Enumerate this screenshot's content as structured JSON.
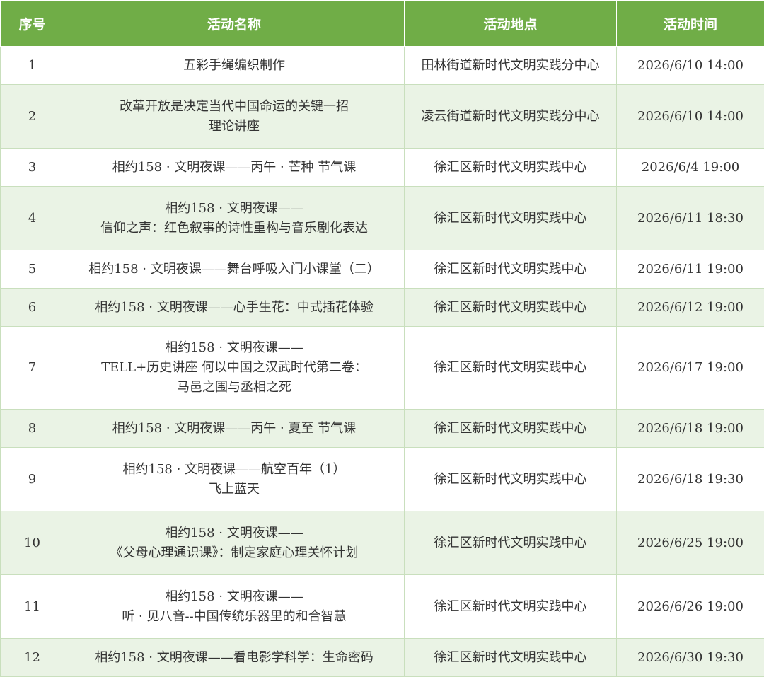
{
  "colors": {
    "header_bg": "#70ad47",
    "header_text": "#ffffff",
    "row_alt_bg": "#eaf3e5",
    "row_bg": "#ffffff",
    "border": "#c9dfbd"
  },
  "table": {
    "headers": {
      "no": "序号",
      "name": "活动名称",
      "place": "活动地点",
      "time": "活动时间"
    },
    "rows": [
      {
        "no": "1",
        "name": [
          "五彩手绳编织制作"
        ],
        "place": "田林街道新时代文明实践分中心",
        "time": "2026/6/10 14:00"
      },
      {
        "no": "2",
        "name": [
          "改革开放是决定当代中国命运的关键一招",
          "理论讲座"
        ],
        "place": "凌云街道新时代文明实践分中心",
        "time": "2026/6/10 14:00"
      },
      {
        "no": "3",
        "name": [
          "相约158 · 文明夜课——丙午 · 芒种 节气课"
        ],
        "place": "徐汇区新时代文明实践中心",
        "time": "2026/6/4 19:00"
      },
      {
        "no": "4",
        "name": [
          "相约158 · 文明夜课——",
          "信仰之声：红色叙事的诗性重构与音乐剧化表达"
        ],
        "place": "徐汇区新时代文明实践中心",
        "time": "2026/6/11 18:30"
      },
      {
        "no": "5",
        "name": [
          "相约158 · 文明夜课——舞台呼吸入门小课堂（二）"
        ],
        "place": "徐汇区新时代文明实践中心",
        "time": "2026/6/11 19:00"
      },
      {
        "no": "6",
        "name": [
          "相约158 · 文明夜课——心手生花：中式插花体验"
        ],
        "place": "徐汇区新时代文明实践中心",
        "time": "2026/6/12 19:00"
      },
      {
        "no": "7",
        "name": [
          "相约158 · 文明夜课——",
          "TELL+历史讲座 何以中国之汉武时代第二卷：",
          "马邑之围与丞相之死"
        ],
        "place": "徐汇区新时代文明实践中心",
        "time": "2026/6/17 19:00"
      },
      {
        "no": "8",
        "name": [
          "相约158 · 文明夜课——丙午 · 夏至 节气课"
        ],
        "place": "徐汇区新时代文明实践中心",
        "time": "2026/6/18 19:00"
      },
      {
        "no": "9",
        "name": [
          "相约158 · 文明夜课——航空百年（1）",
          "飞上蓝天"
        ],
        "place": "徐汇区新时代文明实践中心",
        "time": "2026/6/18 19:30"
      },
      {
        "no": "10",
        "name": [
          "相约158 · 文明夜课——",
          "《父母心理通识课》：制定家庭心理关怀计划"
        ],
        "place": "徐汇区新时代文明实践中心",
        "time": "2026/6/25 19:00"
      },
      {
        "no": "11",
        "name": [
          "相约158 · 文明夜课——",
          "听 · 见八音--中国传统乐器里的和合智慧"
        ],
        "place": "徐汇区新时代文明实践中心",
        "time": "2026/6/26 19:00"
      },
      {
        "no": "12",
        "name": [
          "相约158 · 文明夜课——看电影学科学：生命密码"
        ],
        "place": "徐汇区新时代文明实践中心",
        "time": "2026/6/30 19:30"
      }
    ]
  }
}
